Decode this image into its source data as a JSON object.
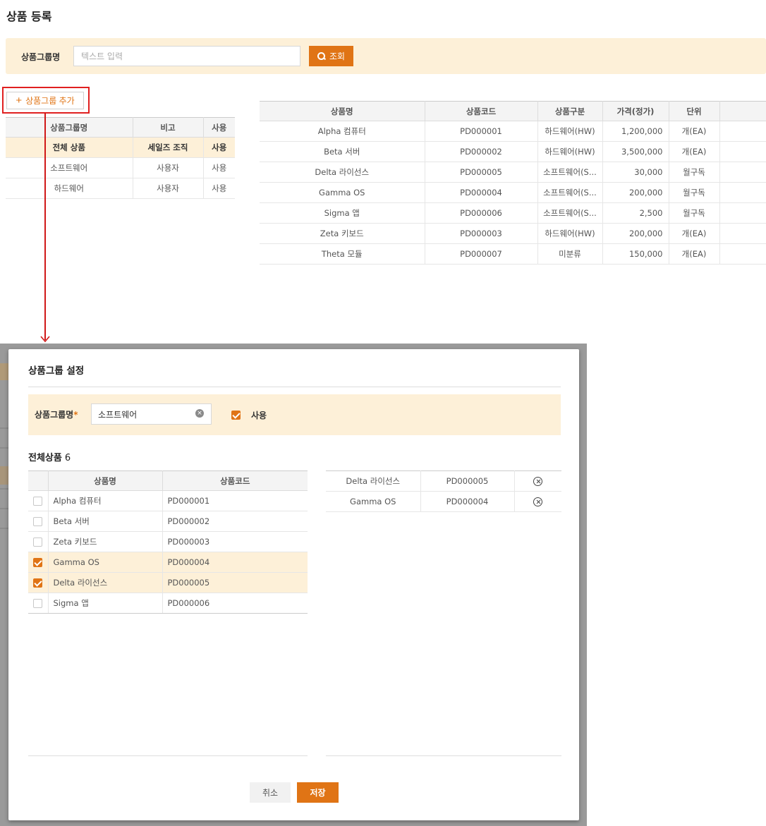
{
  "page": {
    "title": "상품 등록"
  },
  "search": {
    "label": "상품그룹명",
    "placeholder": "텍스트 입력",
    "value": "",
    "button_label": "조회"
  },
  "add_group_button": {
    "label": "상품그룹 추가"
  },
  "group_table": {
    "columns": [
      "상품그룹명",
      "비고",
      "사용"
    ],
    "rows": [
      {
        "name": "전체 상품",
        "note": "세일즈 조직",
        "use": "사용",
        "selected": true
      },
      {
        "name": "소프트웨어",
        "note": "사용자",
        "use": "사용",
        "selected": false
      },
      {
        "name": "하드웨어",
        "note": "사용자",
        "use": "사용",
        "selected": false
      }
    ]
  },
  "product_table": {
    "columns": [
      "상품명",
      "상품코드",
      "상품구분",
      "가격(정가)",
      "단위",
      ""
    ],
    "rows": [
      {
        "name": "Alpha 컴퓨터",
        "code": "PD000001",
        "type": "하드웨어(HW)",
        "price": "1,200,000",
        "unit": "개(EA)"
      },
      {
        "name": "Beta 서버",
        "code": "PD000002",
        "type": "하드웨어(HW)",
        "price": "3,500,000",
        "unit": "개(EA)"
      },
      {
        "name": "Delta 라이선스",
        "code": "PD000005",
        "type": "소프트웨어(S...",
        "price": "30,000",
        "unit": "월구독"
      },
      {
        "name": "Gamma OS",
        "code": "PD000004",
        "type": "소프트웨어(S...",
        "price": "200,000",
        "unit": "월구독"
      },
      {
        "name": "Sigma 앱",
        "code": "PD000006",
        "type": "소프트웨어(S...",
        "price": "2,500",
        "unit": "월구독"
      },
      {
        "name": "Zeta 키보드",
        "code": "PD000003",
        "type": "하드웨어(HW)",
        "price": "200,000",
        "unit": "개(EA)"
      },
      {
        "name": "Theta 모듈",
        "code": "PD000007",
        "type": "미분류",
        "price": "150,000",
        "unit": "개(EA)"
      }
    ]
  },
  "modal": {
    "title": "상품그룹 설정",
    "group_name_label": "상품그룹명",
    "required_mark": "*",
    "group_name_value": "소프트웨어",
    "clear_icon": "clear-circle-icon",
    "use_label": "사용",
    "use_checked": true,
    "all_products_title": "전체상품",
    "all_products_count": "6",
    "list_columns": [
      "상품명",
      "상품코드"
    ],
    "list_rows": [
      {
        "name": "Alpha 컴퓨터",
        "code": "PD000001",
        "checked": false
      },
      {
        "name": "Beta 서버",
        "code": "PD000002",
        "checked": false
      },
      {
        "name": "Zeta 키보드",
        "code": "PD000003",
        "checked": false
      },
      {
        "name": "Gamma OS",
        "code": "PD000004",
        "checked": true
      },
      {
        "name": "Delta 라이선스",
        "code": "PD000005",
        "checked": true
      },
      {
        "name": "Sigma 앱",
        "code": "PD000006",
        "checked": false
      }
    ],
    "selected_rows": [
      {
        "name": "Delta 라이선스",
        "code": "PD000005",
        "icon": "remove-circle-icon"
      },
      {
        "name": "Gamma OS",
        "code": "PD000004",
        "icon": "remove-circle-icon"
      }
    ],
    "cancel_label": "취소",
    "save_label": "저장"
  },
  "colors": {
    "accent": "#e07415",
    "highlight_bg": "#fdf0d8",
    "annotation_red": "#e02020"
  }
}
